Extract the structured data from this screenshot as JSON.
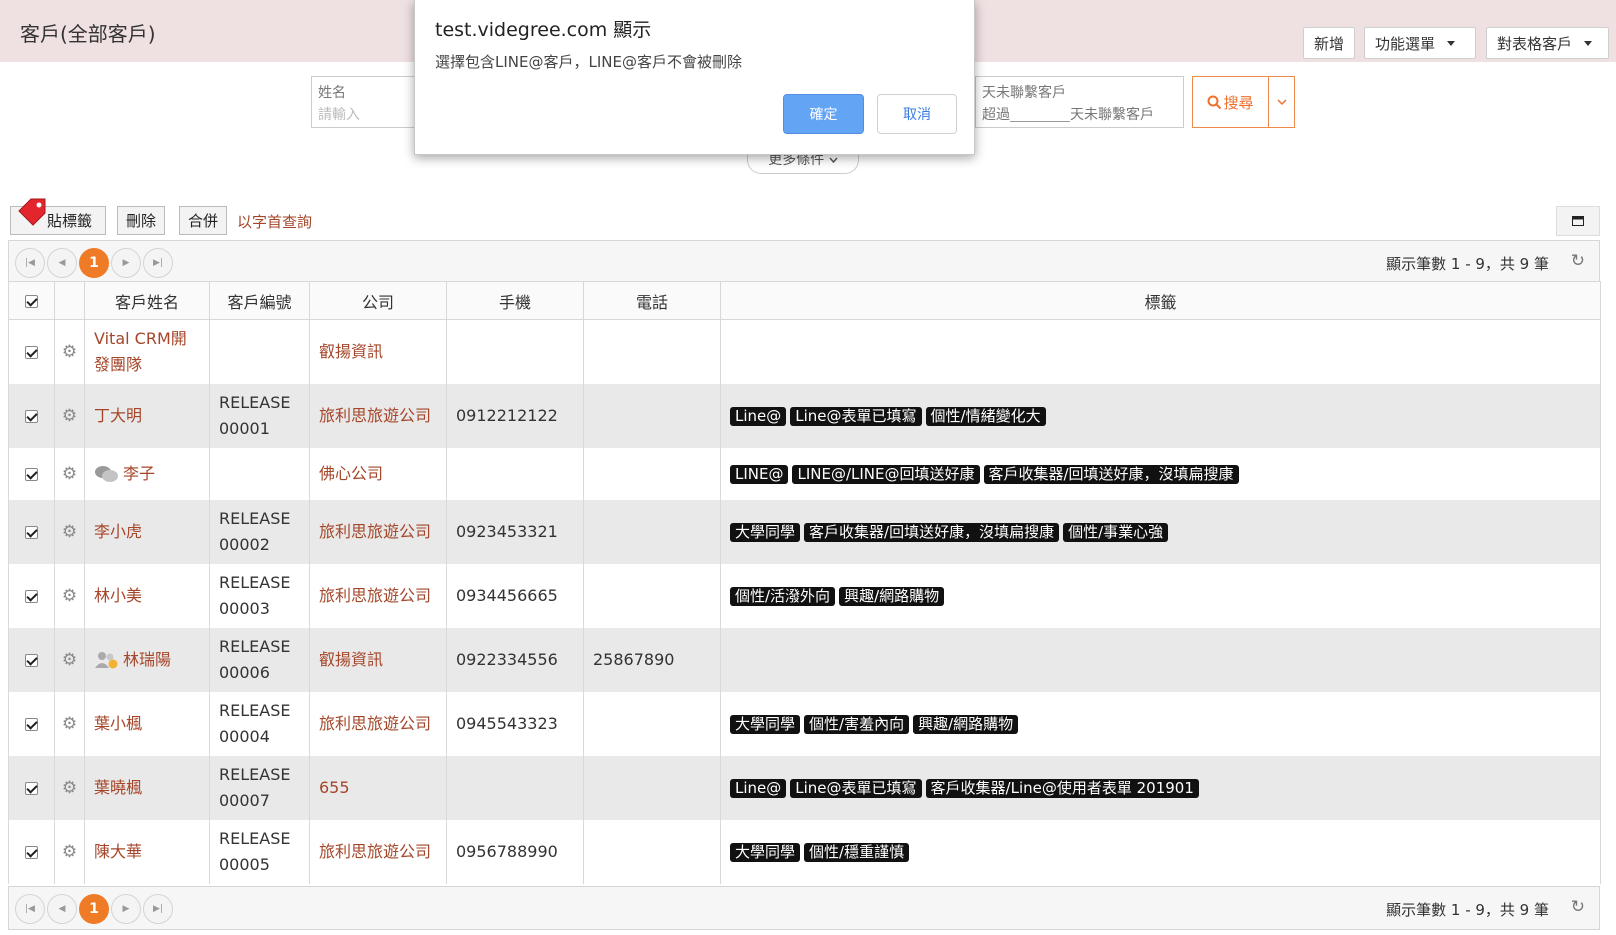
{
  "header": {
    "title": "客戶(全部客戶)",
    "add_label": "新增",
    "menu_label": "功能選單",
    "target_label": "對表格客戶"
  },
  "search": {
    "name_label": "姓名",
    "name_placeholder": "請輸入",
    "days_label": "天未聯繫客戶",
    "days_prefix": "超過",
    "days_suffix": "天未聯繫客戶",
    "search_label": "搜尋",
    "more_label": "更多條件"
  },
  "toolbar": {
    "tag_label": "貼標籤",
    "delete_label": "刪除",
    "merge_label": "合併",
    "alpha_label": "以字首查詢"
  },
  "pager": {
    "current_page": "1",
    "info": "顯示筆數 1 - 9，共 9 筆"
  },
  "table": {
    "headers": [
      "客戶姓名",
      "客戶編號",
      "公司",
      "手機",
      "電話",
      "標籤"
    ],
    "rows": [
      {
        "name": "Vital CRM開發團隊",
        "code": "",
        "company": "叡揚資訊",
        "mobile": "",
        "phone": "",
        "tags": [],
        "icon": ""
      },
      {
        "name": "丁大明",
        "code": "RELEASE00001",
        "company": "旅利思旅遊公司",
        "mobile": "0912212122",
        "phone": "",
        "tags": [
          "Line@",
          "Line@表單已填寫",
          "個性/情緒變化大"
        ],
        "icon": ""
      },
      {
        "name": "李子",
        "code": "",
        "company": "佛心公司",
        "mobile": "",
        "phone": "",
        "tags": [
          "LINE@",
          "LINE@/LINE@回填送好康",
          "客戶收集器/回填送好康，沒填扁搜康"
        ],
        "icon": "chat"
      },
      {
        "name": "李小虎",
        "code": "RELEASE00002",
        "company": "旅利思旅遊公司",
        "mobile": "0923453321",
        "phone": "",
        "tags": [
          "大學同學",
          "客戶收集器/回填送好康，沒填扁搜康",
          "個性/事業心強"
        ],
        "icon": ""
      },
      {
        "name": "林小美",
        "code": "RELEASE00003",
        "company": "旅利思旅遊公司",
        "mobile": "0934456665",
        "phone": "",
        "tags": [
          "個性/活潑外向",
          "興趣/網路購物"
        ],
        "icon": ""
      },
      {
        "name": "林瑞陽",
        "code": "RELEASE00006",
        "company": "叡揚資訊",
        "mobile": "0922334556",
        "phone": "25867890",
        "tags": [],
        "icon": "user"
      },
      {
        "name": "葉小楓",
        "code": "RELEASE00004",
        "company": "旅利思旅遊公司",
        "mobile": "0945543323",
        "phone": "",
        "tags": [
          "大學同學",
          "個性/害羞內向",
          "興趣/網路購物"
        ],
        "icon": ""
      },
      {
        "name": "葉曉楓",
        "code": "RELEASE00007",
        "company": "655",
        "mobile": "",
        "phone": "",
        "tags": [
          "Line@",
          "Line@表單已填寫",
          "客戶收集器/Line@使用者表單 201901"
        ],
        "icon": ""
      },
      {
        "name": "陳大華",
        "code": "RELEASE00005",
        "company": "旅利思旅遊公司",
        "mobile": "0956788990",
        "phone": "",
        "tags": [
          "大學同學",
          "個性/穩重謹慎"
        ],
        "icon": ""
      }
    ]
  },
  "dialog": {
    "title": "test.videgree.com 顯示",
    "message": "選擇包含LINE@客戶，LINE@客戶不會被刪除",
    "ok_label": "確定",
    "cancel_label": "取消"
  },
  "colors": {
    "accent": "#f07b26",
    "link": "#a5462a",
    "header_bg": "#efe0e2",
    "ok_button": "#63a4f5"
  }
}
